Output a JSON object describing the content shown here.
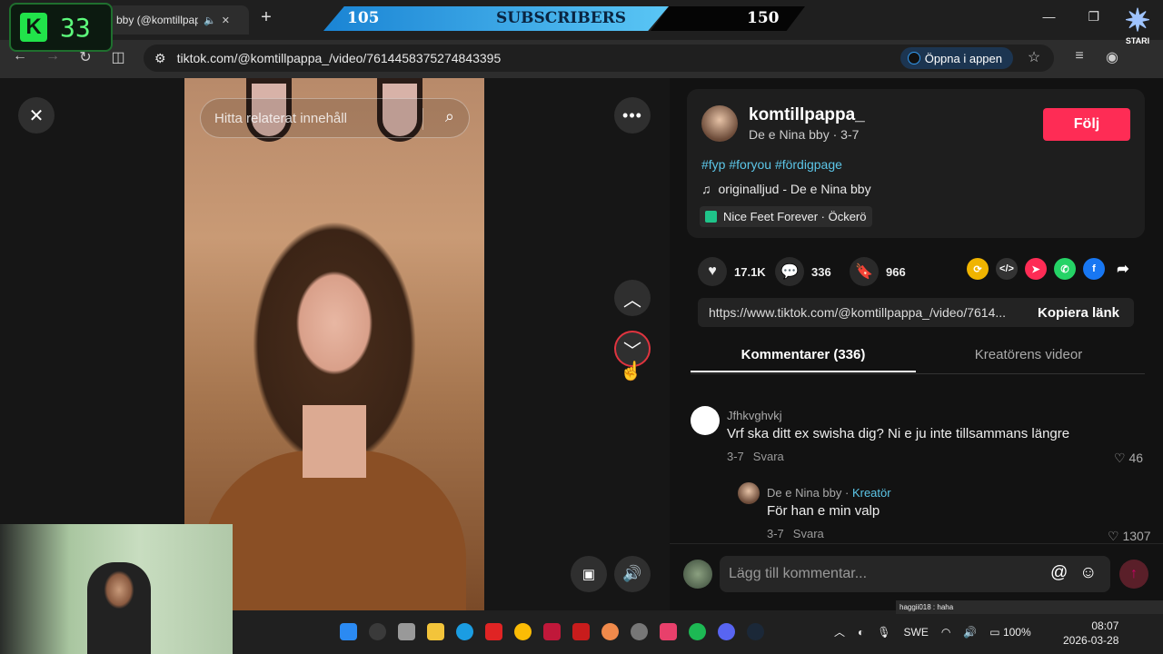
{
  "browser": {
    "tab_title": "bby (@komtillpap",
    "url": "tiktok.com/@komtillpappa_/video/7614458375274843395",
    "open_app": "Öppna i appen"
  },
  "overlay": {
    "kick_count": "33",
    "sub_current": "105",
    "sub_label": "SUBSCRIBERS",
    "sub_goal": "150",
    "stari": "STARI"
  },
  "video": {
    "search_placeholder": "Hitta relaterat innehåll"
  },
  "author": {
    "username": "komtillpappa_",
    "display": "De e Nina bby · 3-7",
    "follow": "Följ",
    "tags": "#fyp #foryou #fördigpage",
    "music": "originalljud - De e Nina bby",
    "location": "Nice Feet Forever · Öckerö"
  },
  "stats": {
    "likes": "17.1K",
    "comments": "336",
    "saves": "966"
  },
  "link": {
    "url": "https://www.tiktok.com/@komtillpappa_/video/7614...",
    "copy": "Kopiera länk"
  },
  "tabs": {
    "comments": "Kommentarer (336)",
    "creator_videos": "Kreatörens videor"
  },
  "comments": [
    {
      "user": "Jfhkvghvkj",
      "text": "Vrf ska ditt ex swisha dig? Ni e ju inte tillsammans längre",
      "date": "3-7",
      "reply": "Svara",
      "likes": "46"
    },
    {
      "user": "De e Nina bby",
      "badge": "Kreatör",
      "text": "För han e min valp",
      "date": "3-7",
      "reply": "Svara",
      "likes": "1307"
    }
  ],
  "comment_input": {
    "placeholder": "Lägg till kommentar..."
  },
  "taskbar": {
    "lang": "SWE",
    "battery": "100%",
    "time": "08:07",
    "date": "2026-03-28",
    "chat": "haggii018 : haha"
  }
}
